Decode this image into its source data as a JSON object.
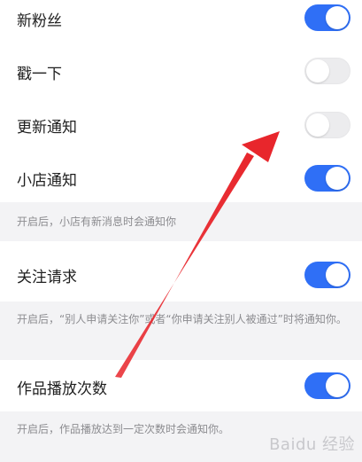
{
  "settings": [
    {
      "label": "新粉丝",
      "enabled": true
    },
    {
      "label": "戳一下",
      "enabled": false
    },
    {
      "label": "更新通知",
      "enabled": false
    },
    {
      "label": "小店通知",
      "enabled": true
    },
    {
      "label": "关注请求",
      "enabled": true
    },
    {
      "label": "作品播放次数",
      "enabled": true
    }
  ],
  "descriptions": {
    "shop": "开启后，小店有新消息时会通知你",
    "follow": "开启后，“别人申请关注你”或者“你申请关注别人被通过”时将通知你。",
    "play": "开启后，作品播放达到一定次数时会通知你。"
  },
  "colors": {
    "toggle_on": "#2f6ff6",
    "toggle_off": "#ececee",
    "annotation_arrow": "#e8262c"
  },
  "watermark": {
    "text": "Baidu 经验"
  }
}
